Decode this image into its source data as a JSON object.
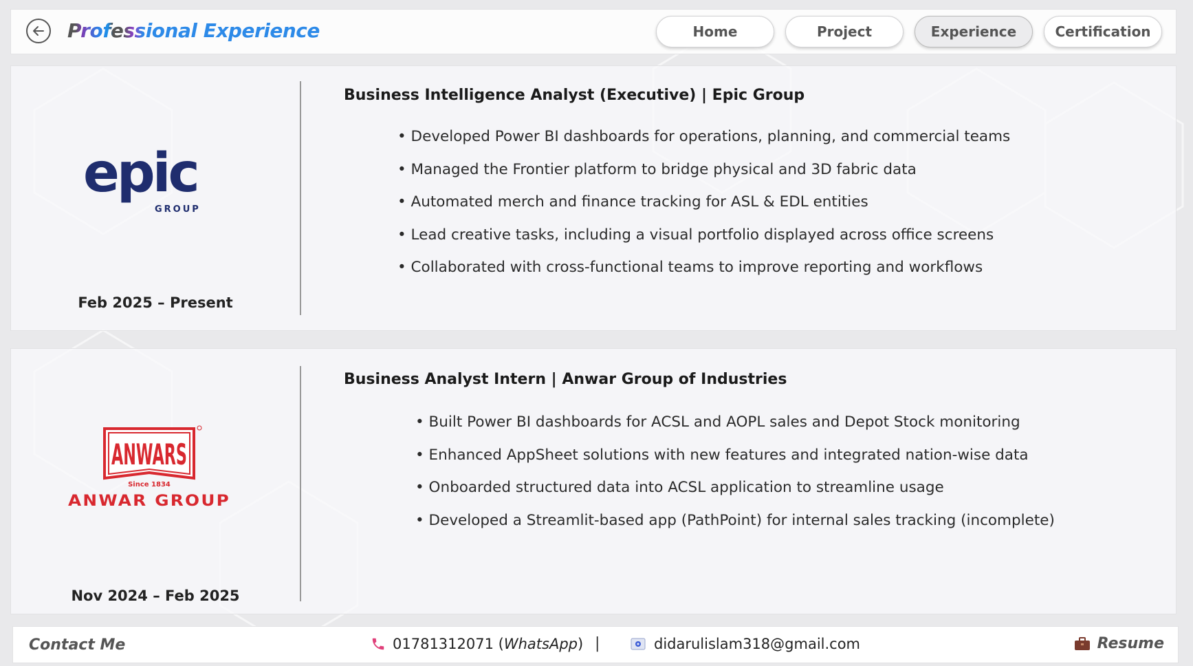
{
  "header": {
    "title": "Professional Experience",
    "back_icon": "arrow-left-circle-icon",
    "nav": [
      {
        "label": "Home",
        "active": false
      },
      {
        "label": "Project",
        "active": false
      },
      {
        "label": "Experience",
        "active": true
      },
      {
        "label": "Certification",
        "active": false
      }
    ]
  },
  "experiences": [
    {
      "logo_text": "epic",
      "logo_sub": "GROUP",
      "logo_color": "#1f2d6e",
      "date": "Feb 2025 – Present",
      "title": "Business Intelligence Analyst (Executive) | Epic Group",
      "bullets": [
        "Developed Power BI dashboards for operations, planning, and commercial teams",
        "Managed the Frontier platform to bridge physical and 3D fabric data",
        "Automated merch and finance tracking for ASL & EDL entities",
        "Lead creative tasks, including a visual portfolio displayed across office screens",
        "Collaborated with cross-functional teams to improve reporting and workflows"
      ]
    },
    {
      "logo_text": "ANWARS",
      "logo_since": "Since 1834",
      "logo_sub": "ANWAR GROUP",
      "logo_color": "#d8282f",
      "date": "Nov 2024 – Feb 2025",
      "title": "Business Analyst Intern | Anwar Group of Industries",
      "bullets": [
        "Built Power BI dashboards for ACSL and AOPL sales and Depot Stock monitoring",
        "Enhanced AppSheet solutions with new features and integrated nation-wise data",
        "Onboarded structured data into ACSL application to streamline usage",
        "Developed a Streamlit-based app (PathPoint) for internal sales tracking (incomplete)"
      ]
    }
  ],
  "footer": {
    "contact_label": "Contact Me",
    "phone": "01781312071",
    "phone_note": "WhatsApp",
    "separator": "|",
    "email": "didarulislam318@gmail.com",
    "resume_label": "Resume",
    "icons": {
      "phone": "phone-icon",
      "email": "email-icon",
      "resume": "briefcase-icon"
    }
  },
  "colors": {
    "accent_purple": "#7b3fb5",
    "accent_blue": "#2d8ae8",
    "phone_pink": "#e0407a",
    "briefcase": "#7a3b2e"
  }
}
